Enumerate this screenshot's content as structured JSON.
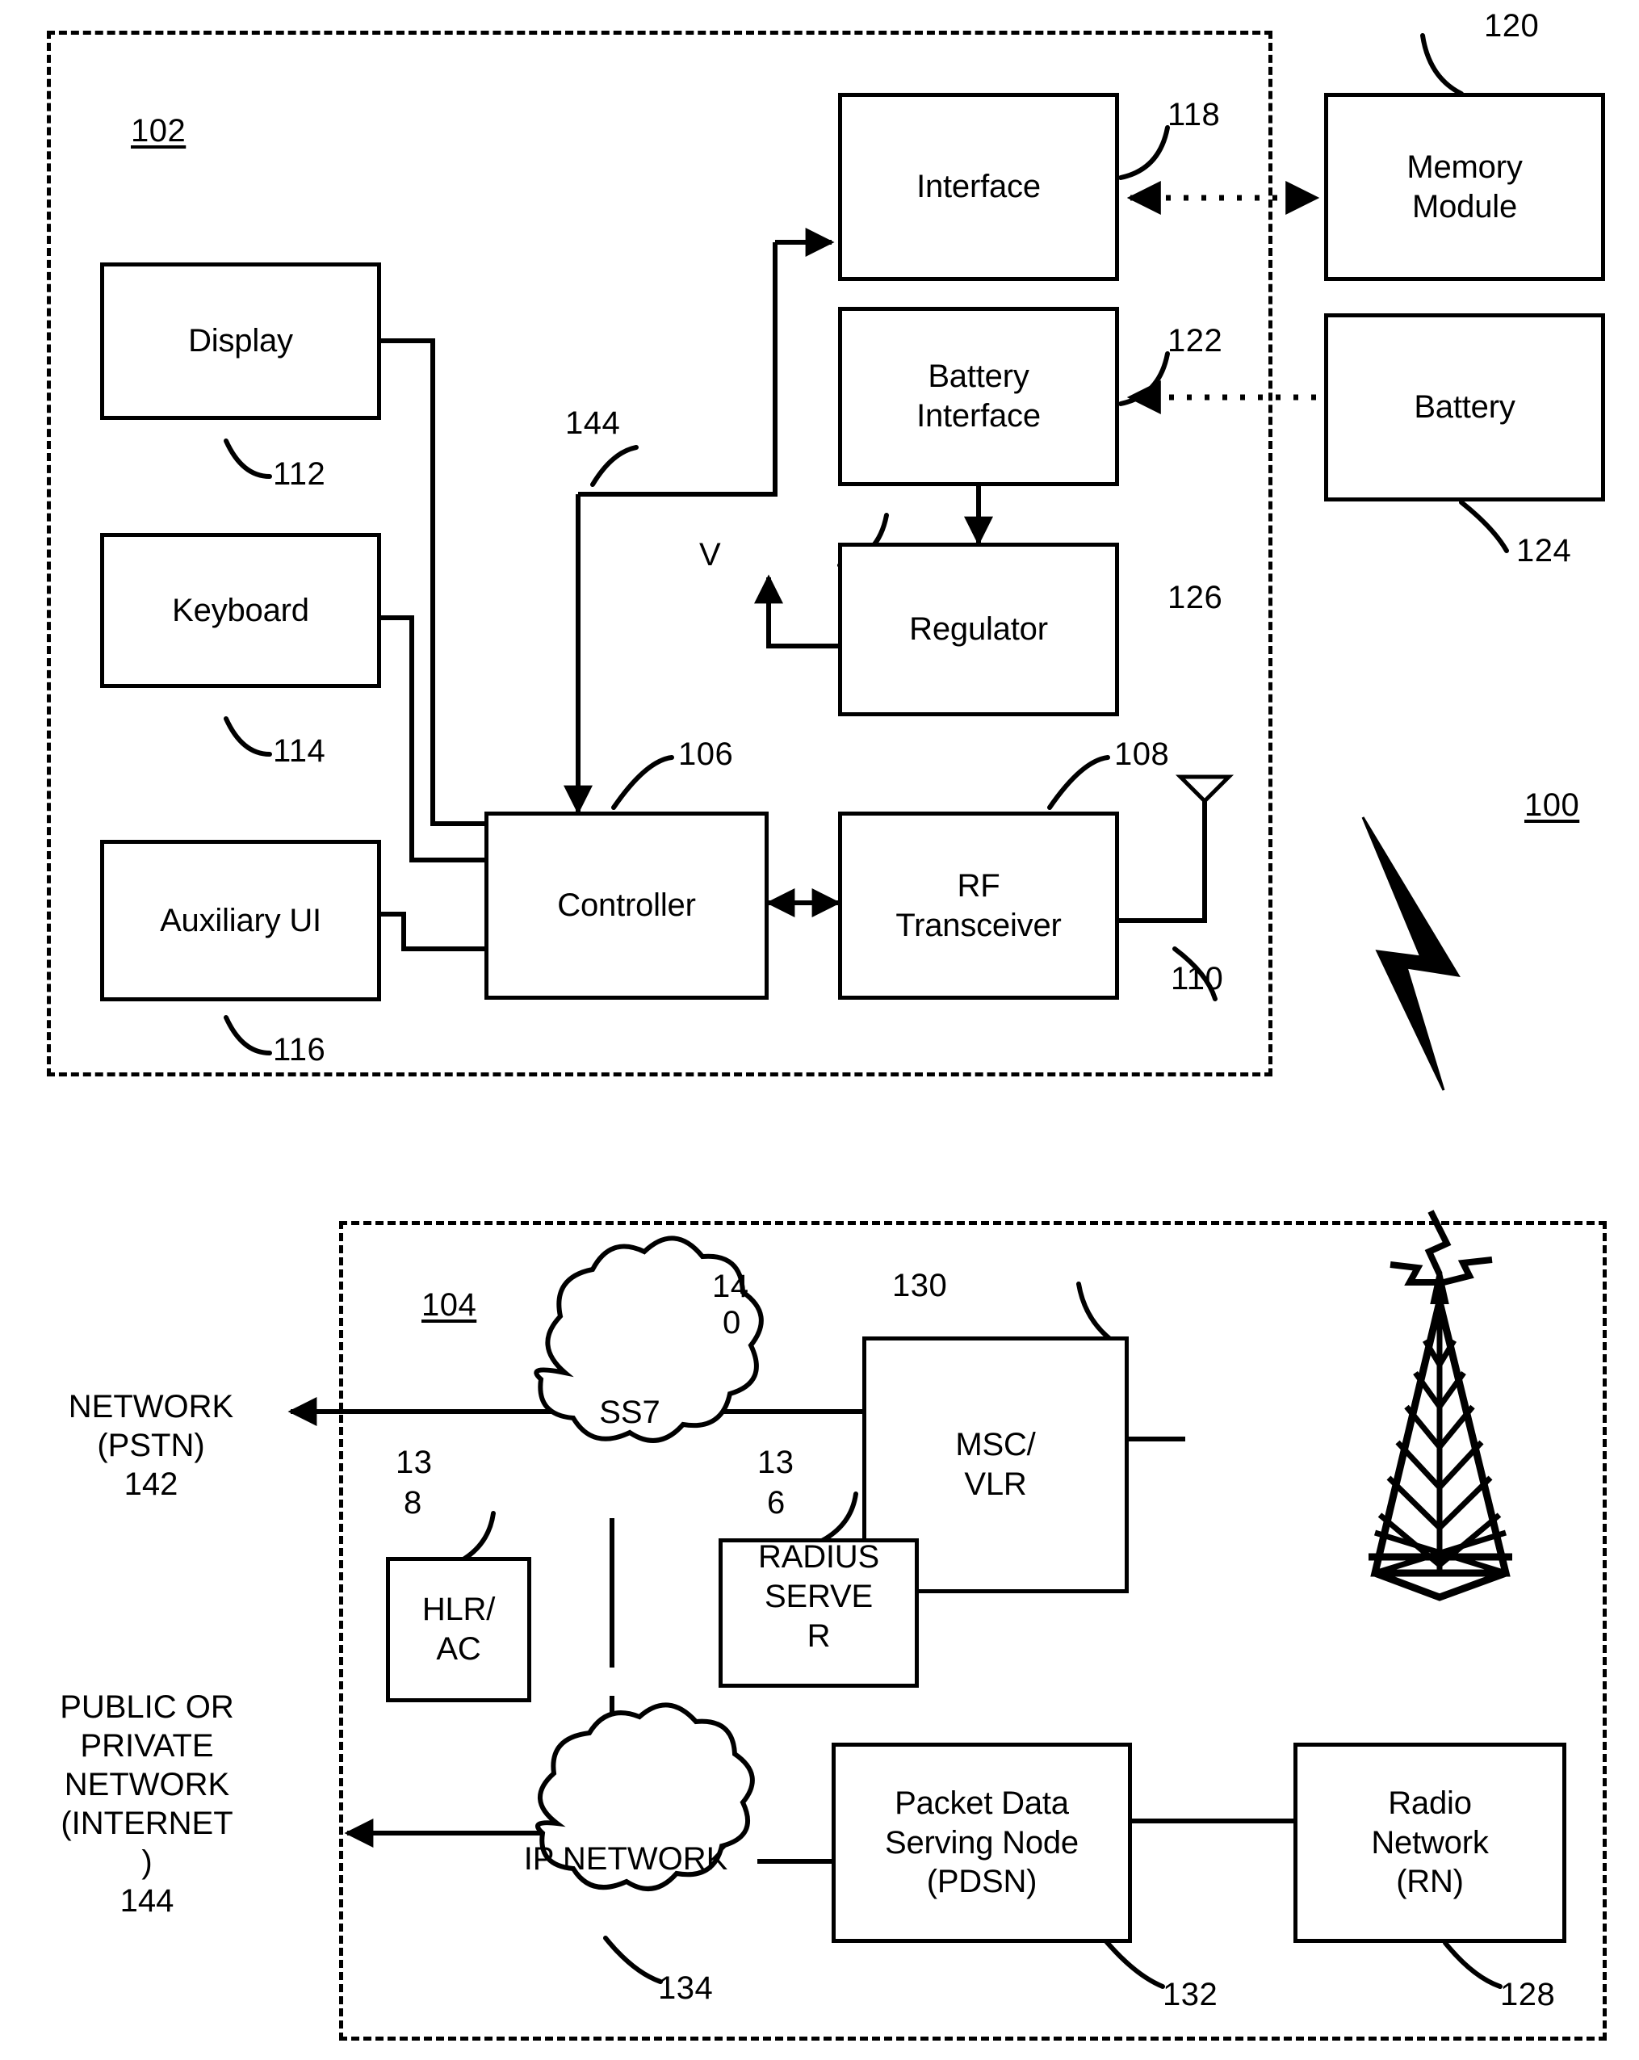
{
  "figure": {
    "overall_numeral": "100",
    "device_numeral": "102",
    "network_numeral": "104"
  },
  "device": {
    "blocks": [
      {
        "id": "display",
        "label": "Display",
        "numeral": "112"
      },
      {
        "id": "keyboard",
        "label": "Keyboard",
        "numeral": "114"
      },
      {
        "id": "auxiliary_ui",
        "label": "Auxiliary UI",
        "numeral": "116"
      },
      {
        "id": "controller",
        "label": "Controller",
        "numeral": "106"
      },
      {
        "id": "rf_transceiver",
        "label": "RF\nTransceiver",
        "numeral": "108"
      },
      {
        "id": "interface",
        "label": "Interface",
        "numeral": "118"
      },
      {
        "id": "battery_interface",
        "label": "Battery\nInterface",
        "numeral": "122"
      },
      {
        "id": "regulator",
        "label": "Regulator",
        "numeral": "126"
      }
    ],
    "external_blocks": [
      {
        "id": "memory_module",
        "label": "Memory\nModule",
        "numeral": "120"
      },
      {
        "id": "battery",
        "label": "Battery",
        "numeral": "124"
      }
    ],
    "antenna_numeral": "110",
    "bus_numeral": "144",
    "voltage_label": "V"
  },
  "network": {
    "blocks": [
      {
        "id": "msc_vlr",
        "label": "MSC/\nVLR",
        "numeral": "130"
      },
      {
        "id": "hlr_ac",
        "label": "HLR/\nAC",
        "numeral": "138"
      },
      {
        "id": "radius_server",
        "label": "RADIUS\nSERVE\nR",
        "numeral": "136"
      },
      {
        "id": "pdsn",
        "label": "Packet Data\nServing Node\n(PDSN)",
        "numeral": "132"
      },
      {
        "id": "radio_network",
        "label": "Radio\nNetwork\n(RN)",
        "numeral": "128"
      }
    ],
    "clouds": [
      {
        "id": "ss7",
        "label": "SS7",
        "numeral": "140"
      },
      {
        "id": "ip_network",
        "label": "IP NETWORK",
        "numeral": "134"
      }
    ],
    "numeral_splits": {
      "ss7_line1": "14",
      "ss7_line2": "0",
      "hlr_line1": "13",
      "hlr_line2": "8",
      "radius_line1": "13",
      "radius_line2": "6"
    },
    "external_labels": [
      {
        "id": "pstn",
        "text": "NETWORK\n(PSTN)\n142"
      },
      {
        "id": "internet",
        "text": "PUBLIC OR\nPRIVATE\nNETWORK\n(INTERNET\n)\n144"
      }
    ],
    "tower_icon": "cell-tower-icon"
  }
}
